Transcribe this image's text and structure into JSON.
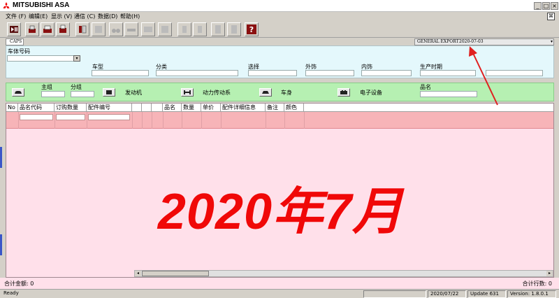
{
  "window": {
    "title": "MITSUBISHI ASA",
    "minimize": "_",
    "maximize": "□",
    "close": "×"
  },
  "menu": {
    "items": [
      "文件 (F)",
      "编辑(E)",
      "显示 (V)",
      "通信 (C)",
      "数据(D)",
      "帮助(H)"
    ]
  },
  "toolbar": {
    "help_label": "?"
  },
  "info": {
    "caps": "CAPS",
    "export_label": "GENERAL EXPORT",
    "export_date": "2020-07-03",
    "dropdown": "▾"
  },
  "filters": {
    "vin_label": "车体号码",
    "model_label": "车型",
    "category_label": "分类",
    "select_label": "选择",
    "exterior_label": "外饰",
    "interior_label": "内饰",
    "production_label": "生产时期",
    "combo_arrow": "▾"
  },
  "categories": {
    "main_group_label": "主组",
    "sub_group_label": "分组",
    "engine_label": "发动机",
    "drivetrain_label": "动力传动系",
    "body_label": "车身",
    "electrical_label": "电子设备",
    "part_name_label": "品名"
  },
  "grid": {
    "columns": [
      "No",
      "品名代码",
      "订购数量",
      "配件编号",
      "",
      "",
      "",
      "品名",
      "数量",
      "单价",
      "配件详细信息",
      "备注",
      "颜色"
    ],
    "watermark": "2020年7月",
    "scroll_left": "◂",
    "scroll_right": "▸"
  },
  "totals": {
    "amount": "合计金额: 0",
    "rows": "合计行数: 0"
  },
  "status": {
    "ready": "Ready",
    "date": "2020/07/22",
    "update": "Update 631",
    "version": "Version: 1.8.0.1"
  },
  "colors": {
    "accent_red": "#f00808",
    "annotation_red": "#e02020",
    "grid_bg": "#ffe0ea",
    "input_row": "#f7b4b8",
    "filter_panel": "#e4f8fc",
    "category_panel": "#b6f0b2"
  }
}
